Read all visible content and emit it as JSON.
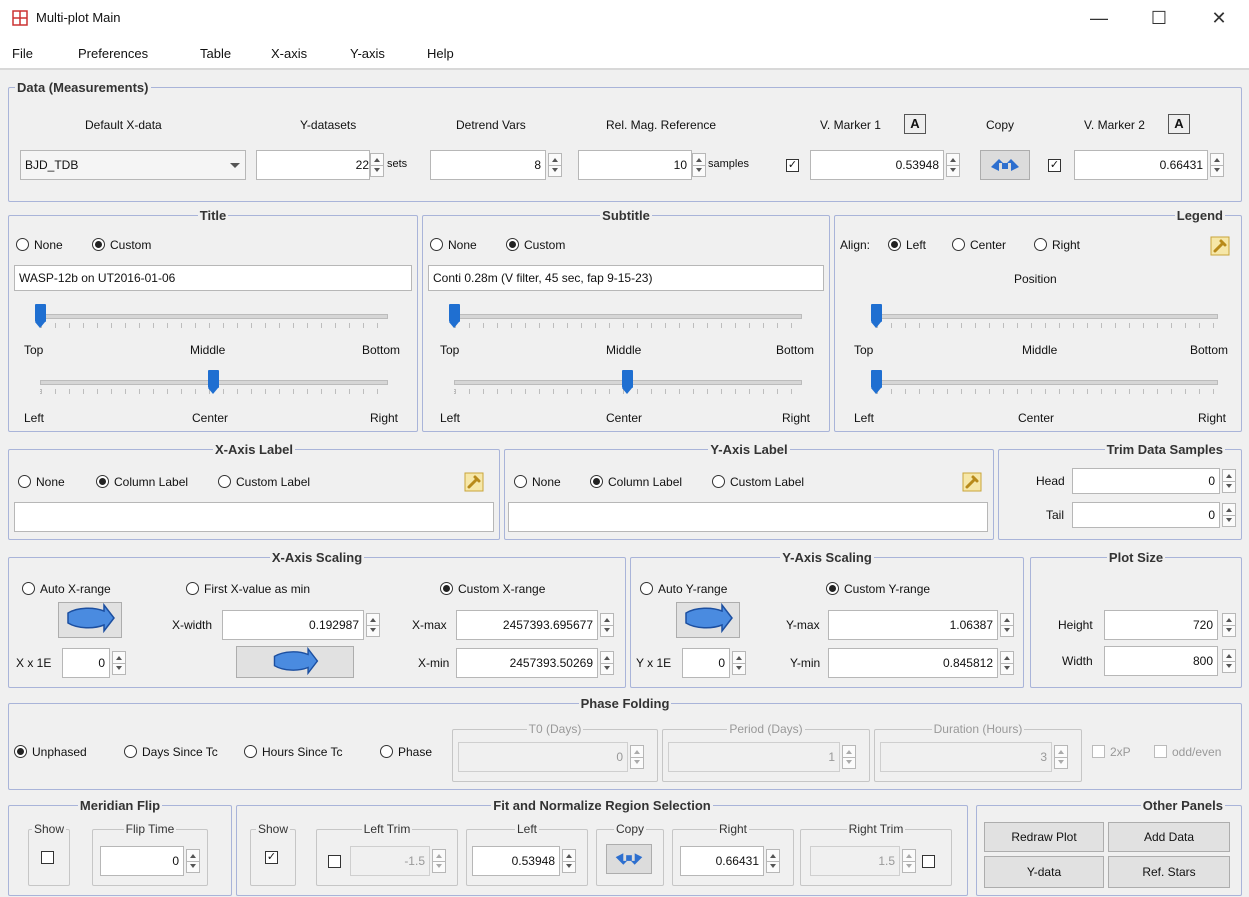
{
  "window": {
    "title": "Multi-plot Main",
    "minimize": "—",
    "maximize": "☐",
    "close": "✕"
  },
  "menu": [
    "File",
    "Preferences",
    "Table",
    "X-axis",
    "Y-axis",
    "Help"
  ],
  "data_measurements": {
    "title": "Data (Measurements)",
    "headers": {
      "default_x": "Default X-data",
      "y_datasets": "Y-datasets",
      "detrend": "Detrend Vars",
      "relmag": "Rel. Mag. Reference",
      "vmarker1": "V. Marker 1",
      "copy": "Copy",
      "vmarker2": "V. Marker 2"
    },
    "default_x_value": "BJD_TDB",
    "y_datasets_value": "22",
    "y_datasets_unit": "sets",
    "detrend_value": "8",
    "relmag_value": "10",
    "relmag_unit": "samples",
    "vmarker1_value": "0.53948",
    "vmarker2_value": "0.66431",
    "a_label": "A"
  },
  "title_panel": {
    "title": "Title",
    "none": "None",
    "custom": "Custom",
    "text": "WASP-12b on UT2016-01-06",
    "top": "Top",
    "middle": "Middle",
    "bottom": "Bottom",
    "left": "Left",
    "center": "Center",
    "right": "Right",
    "v_pos": 0.0,
    "h_pos": 0.5
  },
  "subtitle_panel": {
    "title": "Subtitle",
    "none": "None",
    "custom": "Custom",
    "text": "Conti 0.28m (V filter, 45 sec, fap 9-15-23)",
    "top": "Top",
    "middle": "Middle",
    "bottom": "Bottom",
    "left": "Left",
    "center": "Center",
    "right": "Right",
    "v_pos": 0.0,
    "h_pos": 0.5
  },
  "legend_panel": {
    "title": "Legend",
    "align": "Align:",
    "left": "Left",
    "center": "Center",
    "right": "Right",
    "position": "Position",
    "top": "Top",
    "middle": "Middle",
    "bottom": "Bottom",
    "h_left": "Left",
    "h_center": "Center",
    "h_right": "Right",
    "v_pos": 0.0,
    "h_pos": 0.0
  },
  "xaxis_label": {
    "title": "X-Axis Label",
    "none": "None",
    "column": "Column Label",
    "custom": "Custom Label",
    "value": ""
  },
  "yaxis_label": {
    "title": "Y-Axis Label",
    "none": "None",
    "column": "Column Label",
    "custom": "Custom Label",
    "value": ""
  },
  "trim": {
    "title": "Trim Data Samples",
    "head": "Head",
    "head_value": "0",
    "tail": "Tail",
    "tail_value": "0"
  },
  "xaxis_scaling": {
    "title": "X-Axis Scaling",
    "auto": "Auto X-range",
    "first": "First X-value as min",
    "custom": "Custom X-range",
    "xwidth": "X-width",
    "xwidth_value": "0.192987",
    "xmax": "X-max",
    "xmax_value": "2457393.695677",
    "xmin": "X-min",
    "xmin_value": "2457393.50269",
    "xx1e": "X x 1E",
    "xx1e_value": "0"
  },
  "yaxis_scaling": {
    "title": "Y-Axis Scaling",
    "auto": "Auto Y-range",
    "custom": "Custom Y-range",
    "ymax": "Y-max",
    "ymax_value": "1.06387",
    "ymin": "Y-min",
    "ymin_value": "0.845812",
    "yx1e": "Y x 1E",
    "yx1e_value": "0"
  },
  "plot_size": {
    "title": "Plot Size",
    "height": "Height",
    "height_value": "720",
    "width": "Width",
    "width_value": "800"
  },
  "phase": {
    "title": "Phase Folding",
    "unphased": "Unphased",
    "days": "Days Since Tc",
    "hours": "Hours Since Tc",
    "phase": "Phase",
    "t0": "T0 (Days)",
    "t0_value": "0",
    "period": "Period (Days)",
    "period_value": "1",
    "duration": "Duration (Hours)",
    "duration_value": "3",
    "twoxp": "2xP",
    "oddeven": "odd/even"
  },
  "meridian": {
    "title": "Meridian Flip",
    "show": "Show",
    "fliptime": "Flip Time",
    "fliptime_value": "0"
  },
  "fit": {
    "title": "Fit and Normalize Region Selection",
    "show": "Show",
    "lefttrim": "Left Trim",
    "lefttrim_value": "-1.5",
    "left": "Left",
    "left_value": "0.53948",
    "copy": "Copy",
    "right": "Right",
    "right_value": "0.66431",
    "righttrim": "Right Trim",
    "righttrim_value": "1.5"
  },
  "other": {
    "title": "Other Panels",
    "redraw": "Redraw Plot",
    "adddata": "Add Data",
    "ydata": "Y-data",
    "refstars": "Ref. Stars"
  },
  "colors": {
    "thumb": "#1f6fd1",
    "group_border": "#a9b4d9",
    "arrow": "#2d6fcf",
    "wrench": "#e8c33b"
  }
}
